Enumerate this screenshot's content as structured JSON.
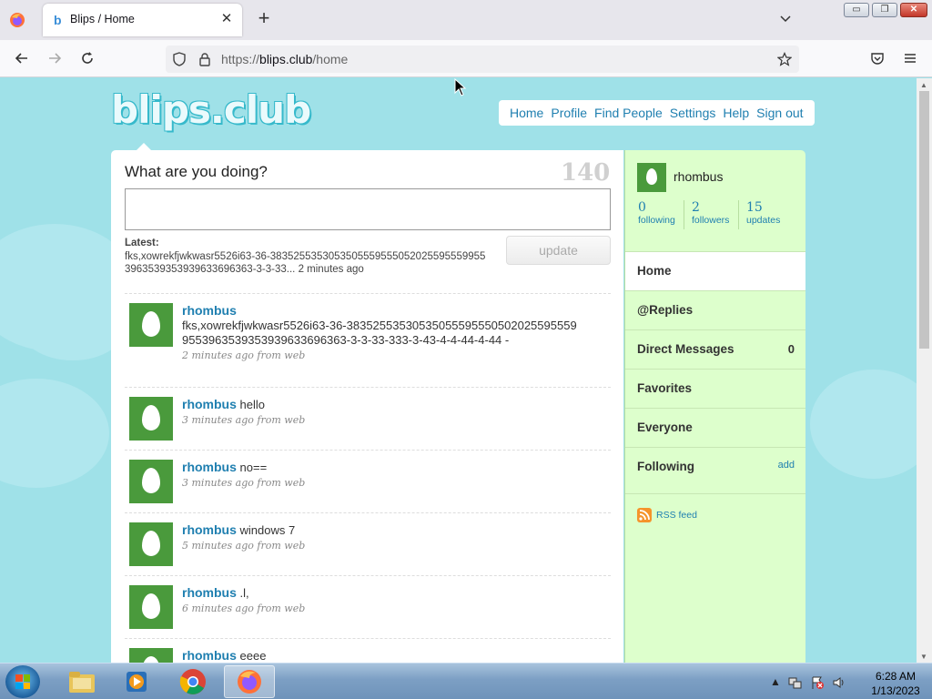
{
  "browser": {
    "tab_title": "Blips / Home",
    "tab_favicon": "b",
    "url_prefix": "https://",
    "url_domain": "blips.club",
    "url_path": "/home",
    "window_buttons": {
      "minimize": "▭",
      "maximize": "❐",
      "close": "✕"
    }
  },
  "site": {
    "logo": "blips.club",
    "topnav": [
      "Home",
      "Profile",
      "Find People",
      "Settings",
      "Help",
      "Sign out"
    ]
  },
  "compose": {
    "prompt": "What are you doing?",
    "char_count": "140",
    "latest_label": "Latest:",
    "latest_text": "fks,xowrekfjwkwasr5526i63-36-383525535305350555955505202559555995539635393539396336963​63-3-3-33...",
    "latest_time": "2 minutes ago",
    "update_button": "update"
  },
  "tweets": [
    {
      "user": "rhombus",
      "text": "fks,xowrekfjwkwasr5526i63-36-3835255353053505559555050202559555995539635393539396336963​63-3-3-33-333-3-43-4-4-44-4-44 -",
      "meta": "2 minutes ago from web"
    },
    {
      "user": "rhombus",
      "text": "hello",
      "meta": "3 minutes ago from web"
    },
    {
      "user": "rhombus",
      "text": "no==",
      "meta": "3 minutes ago from web"
    },
    {
      "user": "rhombus",
      "text": "windows 7",
      "meta": "5 minutes ago from web"
    },
    {
      "user": "rhombus",
      "text": ".l,",
      "meta": "6 minutes ago from web"
    },
    {
      "user": "rhombus",
      "text": "eeee",
      "meta": ""
    }
  ],
  "sidebar": {
    "username": "rhombus",
    "stats": [
      {
        "num": "0",
        "label": "following"
      },
      {
        "num": "2",
        "label": "followers"
      },
      {
        "num": "15",
        "label": "updates"
      }
    ],
    "nav": [
      {
        "label": "Home",
        "active": true
      },
      {
        "label": "@Replies"
      },
      {
        "label": "Direct Messages",
        "count": "0"
      },
      {
        "label": "Favorites"
      },
      {
        "label": "Everyone"
      },
      {
        "label": "Following",
        "extra": "add"
      }
    ],
    "rss": "RSS feed"
  },
  "taskbar": {
    "time": "6:28 AM",
    "date": "1/13/2023",
    "apps": [
      "explorer-icon",
      "media-player-icon",
      "chrome-icon",
      "firefox-icon"
    ]
  },
  "colors": {
    "page_bg": "#9fe1e8",
    "sidebar_bg": "#ddffcc",
    "link": "#1f7fb0",
    "avatar": "#4a9a3c"
  }
}
